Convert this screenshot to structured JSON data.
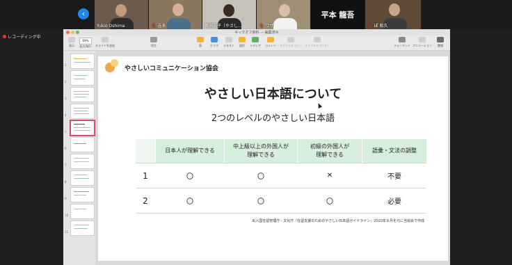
{
  "participants": [
    {
      "name": "Yukio Oshima",
      "muted": false
    },
    {
      "name": "吉永",
      "muted": true
    },
    {
      "name": "奥田友子（やさし...",
      "muted": false
    },
    {
      "name": "ワザ",
      "muted": true
    },
    {
      "name": "平本 龍吾",
      "muted": false
    },
    {
      "name": "ぽ 和久",
      "muted": true
    }
  ],
  "recording_label": "レコーディング中",
  "window_title": "キックオフ資料 — 編集済み",
  "toolbar": {
    "view": "表示",
    "zoom": "69%",
    "zoom_label": "拡大/縮小",
    "add_slide": "スライドを追加",
    "play": "再生",
    "table": "表",
    "chart": "グラフ",
    "text": "テキスト",
    "shape": "図形",
    "media": "メディア",
    "comment": "コメント",
    "copy_style": "スタイルをコピー",
    "paste_style": "スタイルをペースト",
    "format": "フォーマット",
    "animate": "アニメーション",
    "document": "書類"
  },
  "slides": {
    "numbers": [
      "1",
      "2",
      "3",
      "4",
      "5",
      "6",
      "7",
      "8",
      "9",
      "10",
      "11"
    ],
    "selected": "5"
  },
  "slide": {
    "org_name": "やさしいコミュニケーション協会",
    "title": "やさしい日本語について",
    "subtitle": "2つのレベルのやさしい日本語",
    "table": {
      "headers": [
        "",
        "日本人が理解できる",
        "中上級以上の外国人が\n理解できる",
        "初級の外国人が\n理解できる",
        "語彙・文法の調整"
      ],
      "rows": [
        [
          "1",
          "〇",
          "〇",
          "✕",
          "不要"
        ],
        [
          "2",
          "〇",
          "〇",
          "〇",
          "必要"
        ]
      ]
    },
    "source_note": "出入国在留管理庁・文化庁『在留支援のためのやさしい日本語ガイドライン』2020年８月を元に当協会で作成"
  }
}
